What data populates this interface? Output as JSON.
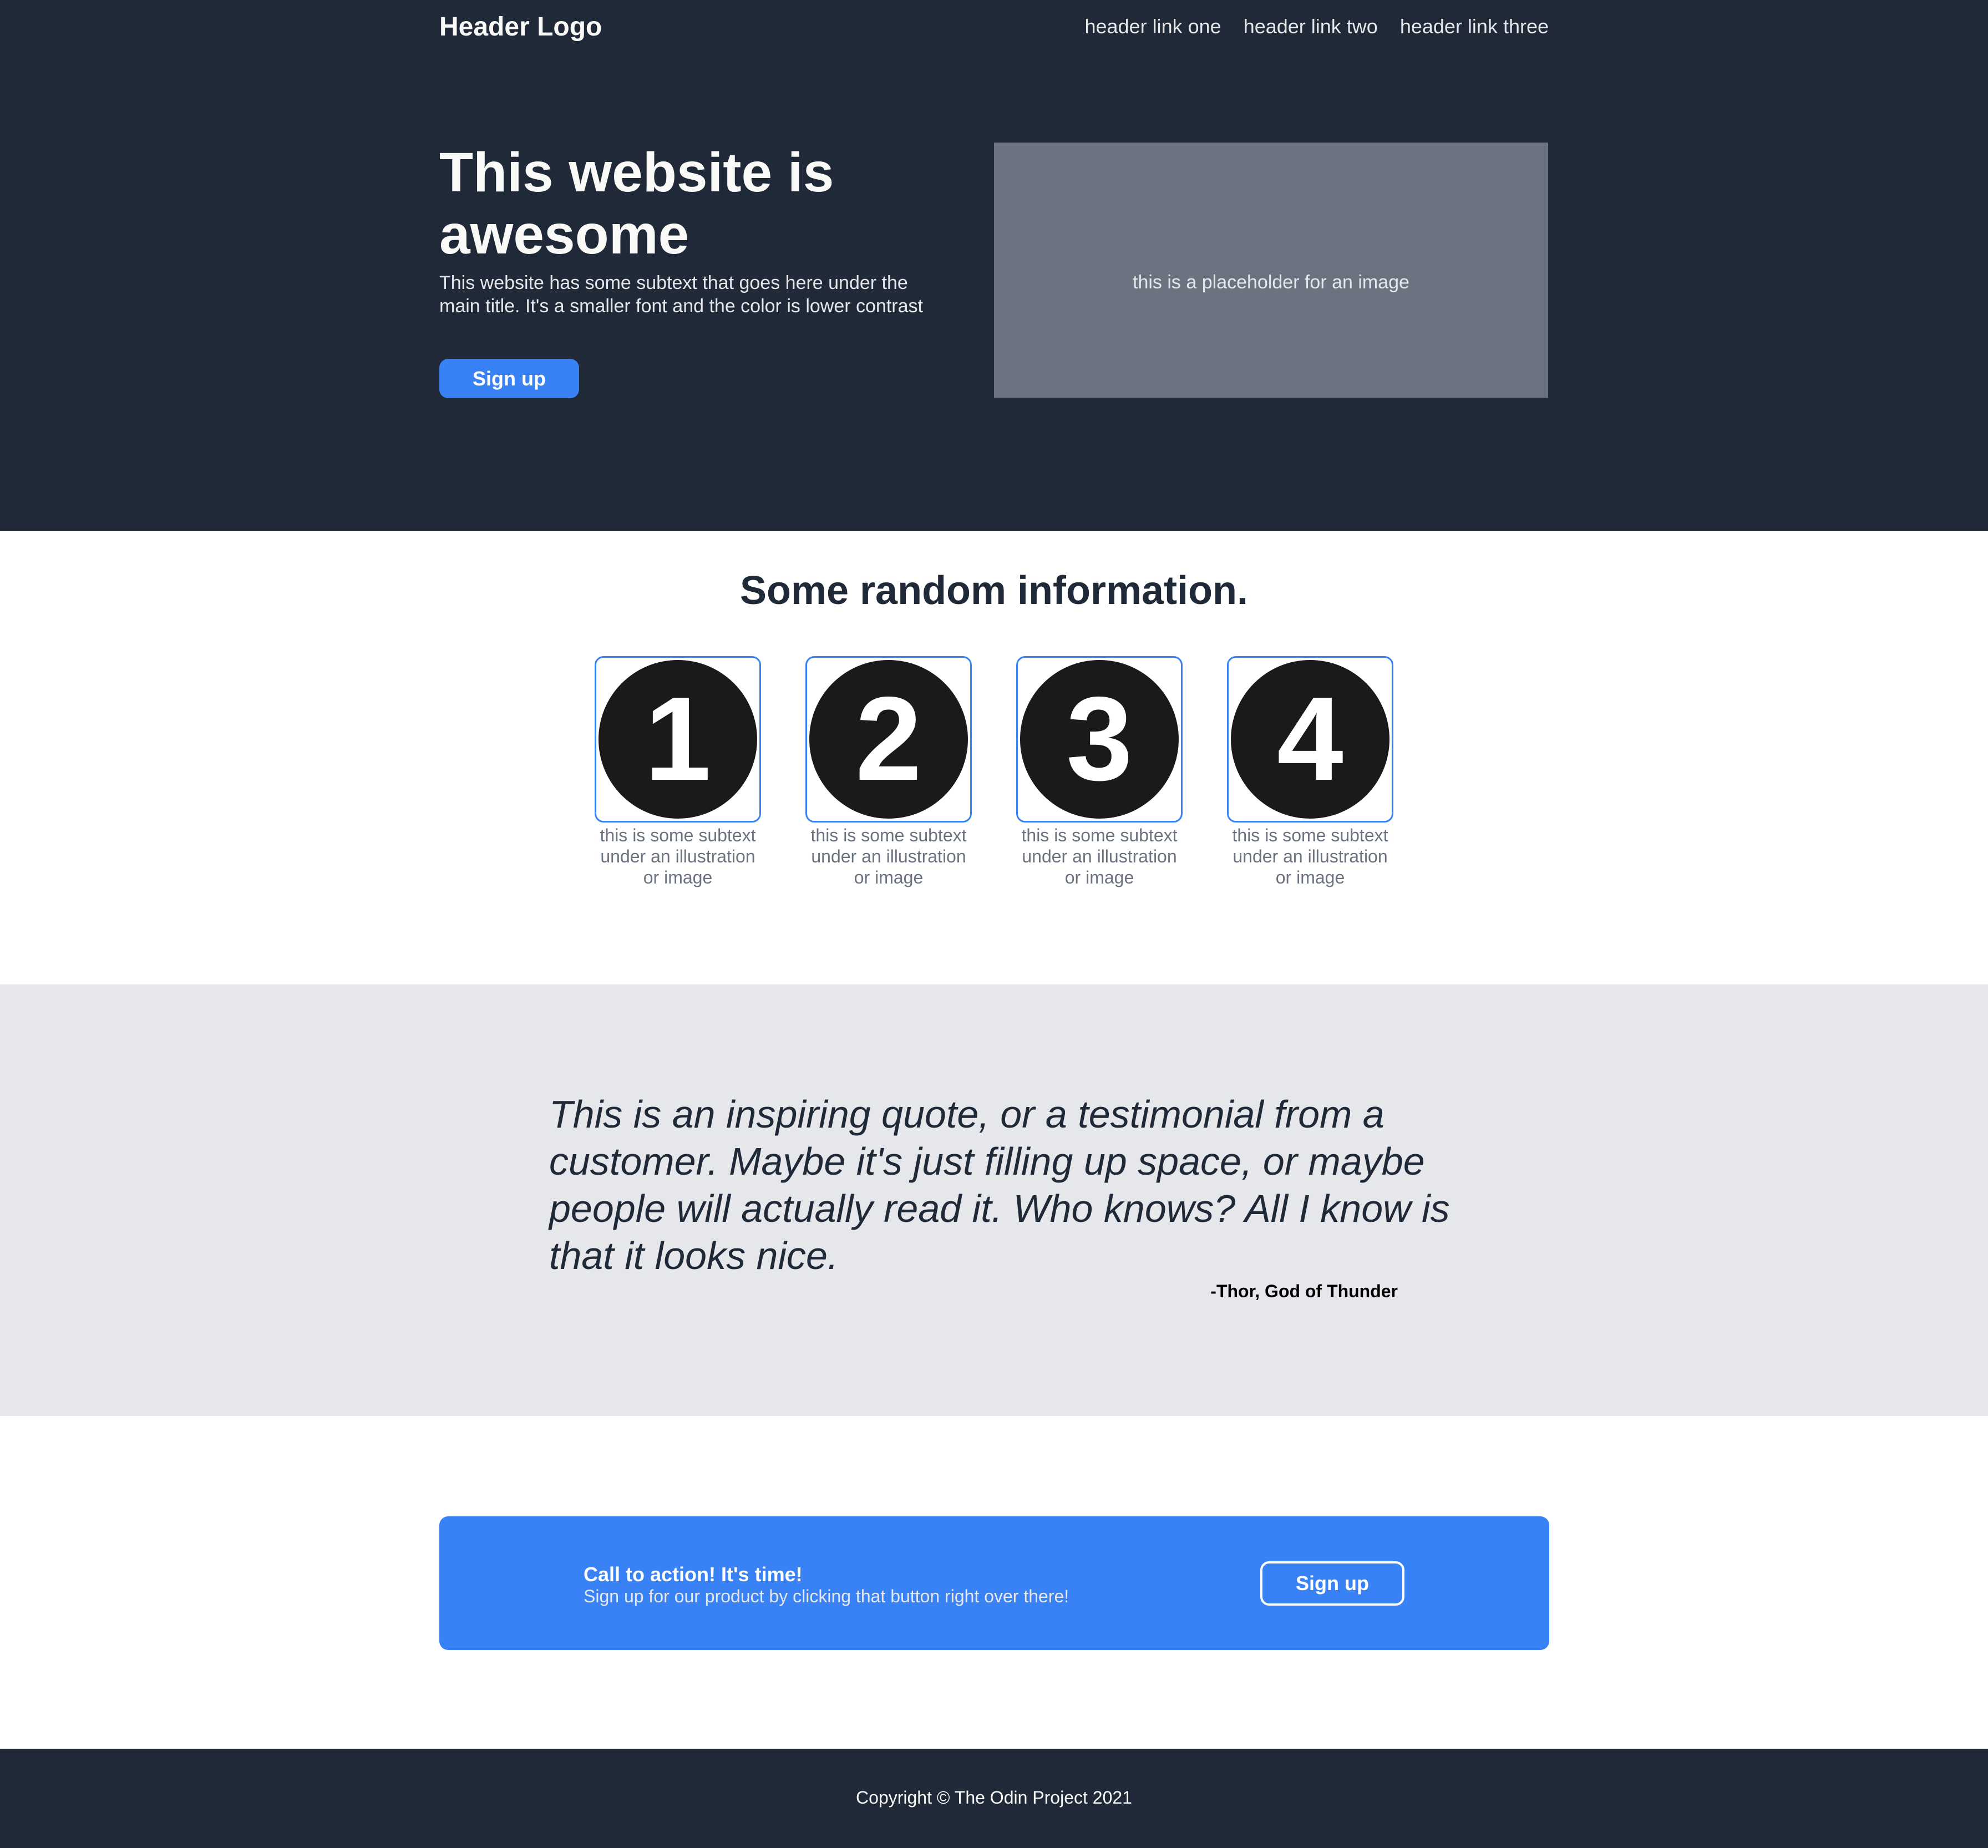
{
  "header": {
    "logo": "Header Logo",
    "links": [
      "header link one",
      "header link two",
      "header link three"
    ]
  },
  "hero": {
    "title": "This website is awesome",
    "subtext": "This website has some subtext that goes here under the main title. It's a smaller font and the color is lower contrast",
    "button_label": "Sign up",
    "image_placeholder": "this is a placeholder for an image"
  },
  "info": {
    "title": "Some random information.",
    "items": [
      {
        "number": "1",
        "icon": "number-one-icon",
        "caption": "this is some subtext under an illustration or image"
      },
      {
        "number": "2",
        "icon": "number-two-icon",
        "caption": "this is some subtext under an illustration or image"
      },
      {
        "number": "3",
        "icon": "number-three-icon",
        "caption": "this is some subtext under an illustration or image"
      },
      {
        "number": "4",
        "icon": "number-four-icon",
        "caption": "this is some subtext under an illustration or image"
      }
    ]
  },
  "quote": {
    "text": "This is an inspiring quote, or a testimonial from a customer. Maybe it's just filling up space, or maybe people will actually read it. Who knows? All I know is that it looks nice.",
    "author": "-Thor, God of Thunder"
  },
  "cta": {
    "title": "Call to action! It's time!",
    "subtext": "Sign up for our product by clicking that button right over there!",
    "button_label": "Sign up"
  },
  "footer": {
    "copyright": "Copyright © The Odin Project 2021"
  },
  "colors": {
    "dark": "#1f2937",
    "accent": "#3882f6",
    "light_text": "#f9faf8",
    "muted": "#6b7280",
    "quote_bg": "#e5e7eb"
  }
}
